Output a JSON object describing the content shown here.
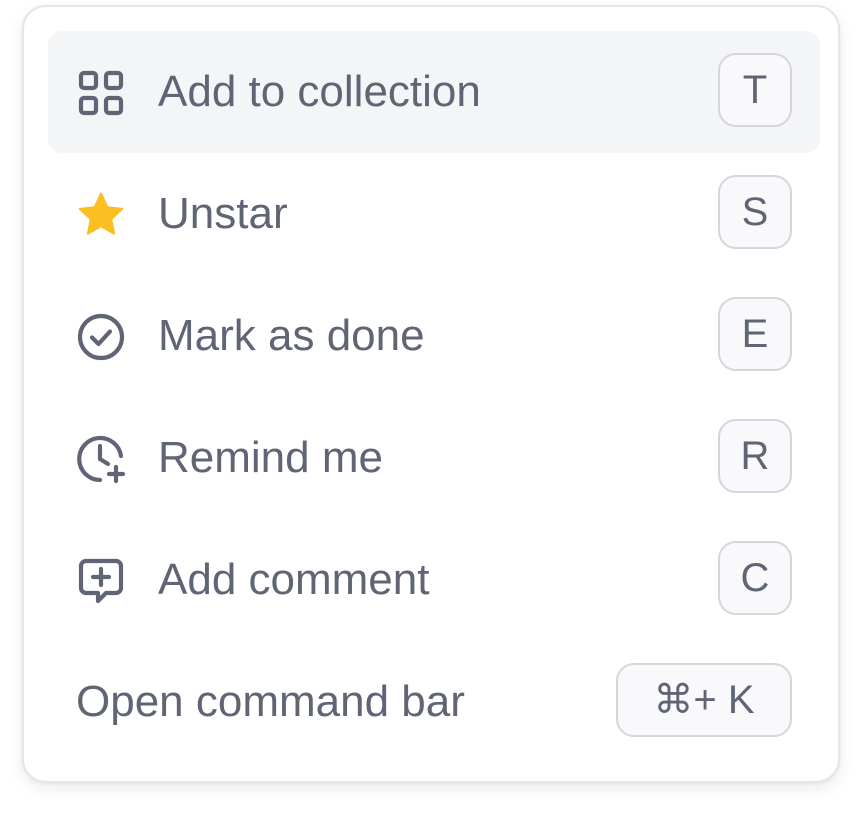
{
  "menu": {
    "items": [
      {
        "label": "Add to collection",
        "shortcut": "T",
        "icon": "grid-icon",
        "active": true
      },
      {
        "label": "Unstar",
        "shortcut": "S",
        "icon": "star-icon",
        "active": false
      },
      {
        "label": "Mark as done",
        "shortcut": "E",
        "icon": "check-circle-icon",
        "active": false
      },
      {
        "label": "Remind me",
        "shortcut": "R",
        "icon": "clock-plus-icon",
        "active": false
      },
      {
        "label": "Add comment",
        "shortcut": "C",
        "icon": "comment-plus-icon",
        "active": false
      },
      {
        "label": "Open command bar",
        "shortcut": "⌘+ K",
        "icon": "",
        "active": false
      }
    ]
  },
  "colors": {
    "text": "#5f6574",
    "star": "#fbbf24",
    "active_row": "#f4f5f7",
    "border": "#e5e6ea",
    "kbd_border": "#d4d6dd"
  }
}
